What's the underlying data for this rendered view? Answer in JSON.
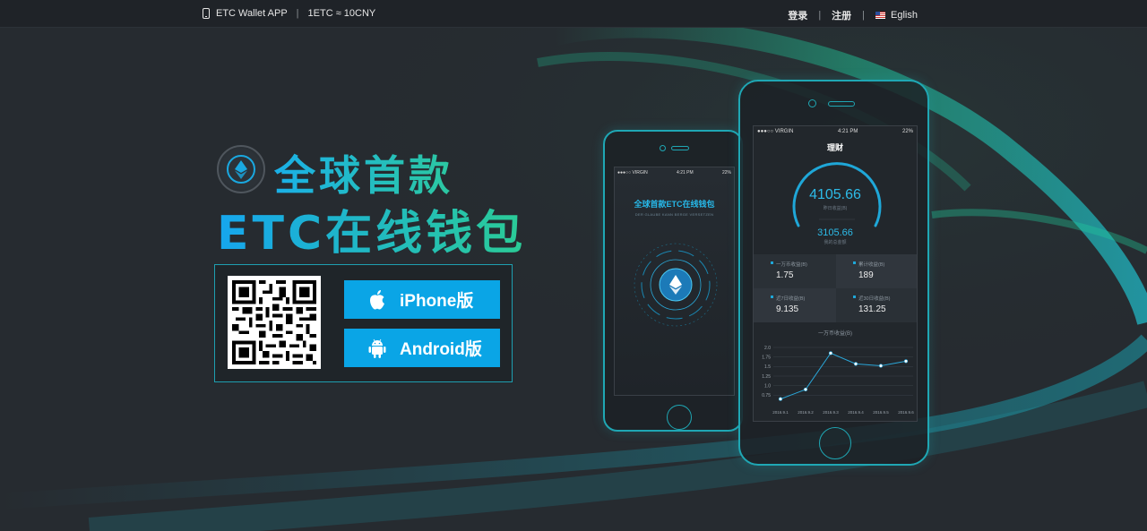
{
  "header": {
    "app_label": "ETC Wallet APP",
    "rate": "1ETC ≈ 10CNY",
    "login": "登录",
    "register": "注册",
    "language": "Eglish",
    "separator": "|"
  },
  "hero": {
    "line1": "全球首款",
    "line2": "ETC在线钱包"
  },
  "download": {
    "iphone_label": "iPhone版",
    "android_label": "Android版"
  },
  "phone_left": {
    "carrier": "●●●○○ VIRGIN",
    "time": "4:21 PM",
    "battery": "22%",
    "title": "全球首款ETC在线钱包",
    "subtitle": "DER GLAUBE KANN BERGE VERSETZEN"
  },
  "phone_right": {
    "carrier": "●●●○○ VIRGIN",
    "time": "4:21 PM",
    "battery": "22%",
    "title": "理财",
    "main_value": "4105.66",
    "main_caption": "昨日收益(B)",
    "second_value": "3105.66",
    "second_caption": "我的总金额",
    "stats": [
      {
        "label": "一万币收益(B)",
        "value": "1.75"
      },
      {
        "label": "累计收益(B)",
        "value": "189"
      },
      {
        "label": "近7日收益(B)",
        "value": "9.135"
      },
      {
        "label": "近30日收益(B)",
        "value": "131.25"
      }
    ]
  },
  "chart_data": {
    "type": "line",
    "title": "一万币收益(B)",
    "x": [
      "2016.9.1",
      "2016.9.2",
      "2016.9.3",
      "2016.9.4",
      "2016.9.5",
      "2016.9.6"
    ],
    "y_ticks": [
      "2.0",
      "1.75",
      "1.5",
      "1.25",
      "1.0",
      "0.75"
    ],
    "values": [
      0.65,
      0.9,
      1.85,
      1.57,
      1.52,
      1.64
    ],
    "ylim": [
      0.5,
      2.0
    ],
    "grid": true,
    "line_color": "#2aa6d8"
  },
  "colors": {
    "accent": "#0aa5e6",
    "teal": "#1fa7b4",
    "background": "#262b30"
  }
}
